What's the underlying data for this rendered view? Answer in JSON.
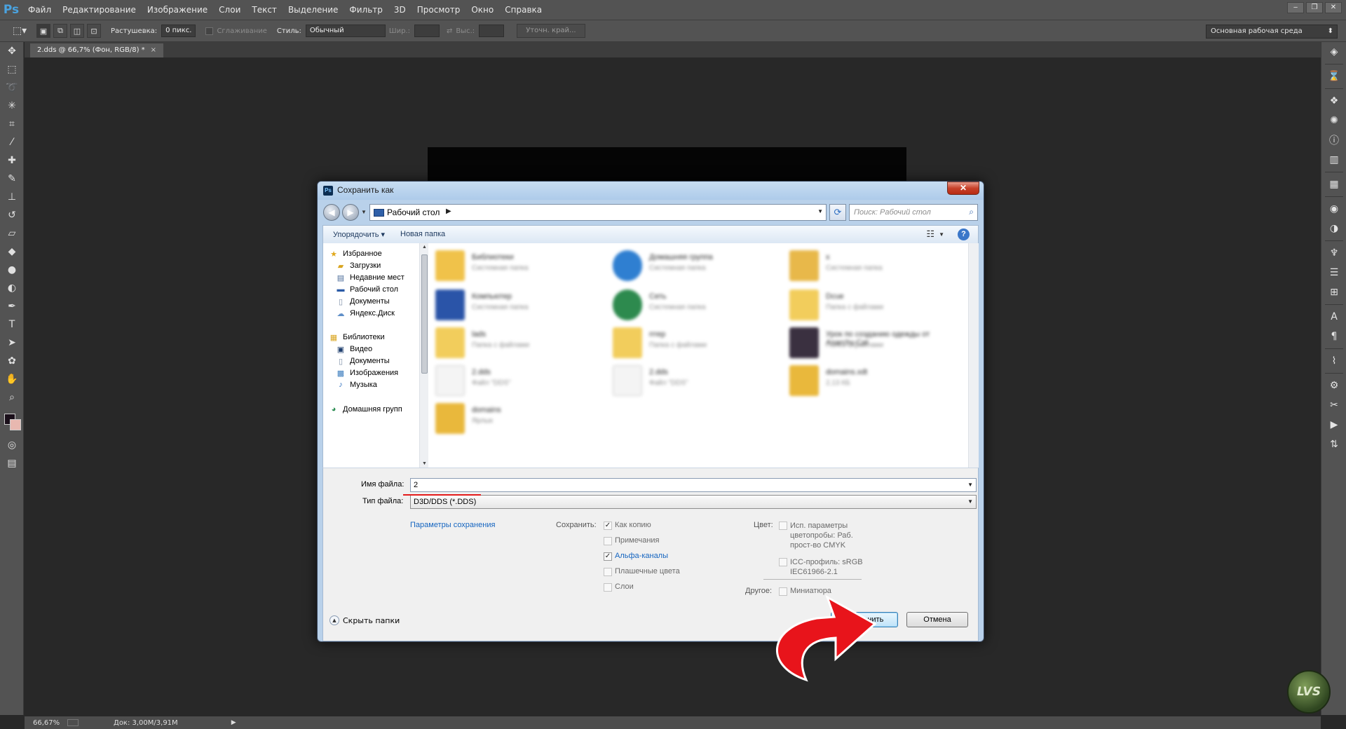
{
  "app": {
    "logo": "Ps",
    "menu": [
      "Файл",
      "Редактирование",
      "Изображение",
      "Слои",
      "Текст",
      "Выделение",
      "Фильтр",
      "3D",
      "Просмотр",
      "Окно",
      "Справка"
    ],
    "window_buttons": [
      "‒",
      "❐",
      "✕"
    ]
  },
  "options": {
    "feather_label": "Растушевка:",
    "feather_value": "0 пикс.",
    "antialias_label": "Сглаживание",
    "style_label": "Стиль:",
    "style_value": "Обычный",
    "width_label": "Шир.:",
    "height_label": "Выс.:",
    "refine_button": "Уточн. край...",
    "workspace": "Основная рабочая среда"
  },
  "document": {
    "tab_title": "2.dds @ 66,7% (Фон, RGB/8) *",
    "tab_close": "×"
  },
  "status": {
    "zoom": "66,67%",
    "doc_info": "Док: 3,00M/3,91M",
    "arrow": "▶"
  },
  "dialog": {
    "title": "Сохранить как",
    "close": "✕",
    "address": "Рабочий стол",
    "search_placeholder": "Поиск: Рабочий стол",
    "toolbar": {
      "organize": "Упорядочить ▾",
      "new_folder": "Новая папка",
      "help": "?"
    },
    "nav": {
      "favorites_header": "Избранное",
      "favorites": [
        "Загрузки",
        "Недавние мест",
        "Рабочий стол",
        "Документы",
        "Яндекс.Диск"
      ],
      "libraries_header": "Библиотеки",
      "libraries": [
        "Видео",
        "Документы",
        "Изображения",
        "Музыка"
      ],
      "homegroup": "Домашняя групп"
    },
    "files": [
      {
        "name": "Библиотеки",
        "sub": "Системная папка",
        "color": "#f0c24a"
      },
      {
        "name": "Домашняя группа",
        "sub": "Системная папка",
        "color": "#2f7fd1"
      },
      {
        "name": "x",
        "sub": "Системная папка",
        "color": "#e8b84a"
      },
      {
        "name": "Компьютер",
        "sub": "Системная папка",
        "color": "#2a54a8"
      },
      {
        "name": "Сеть",
        "sub": "Системная папка",
        "color": "#2d8a4e"
      },
      {
        "name": "Dcue",
        "sub": "Папка с файлами",
        "color": "#f2cd5c"
      },
      {
        "name": "lads",
        "sub": "Папка с файлами",
        "color": "#f2cd5c"
      },
      {
        "name": "rrrеp",
        "sub": "Папка с файлами",
        "color": "#f2cd5c"
      },
      {
        "name": "Урок по созданию одежды от Anarchy Cat",
        "sub": "Папка с файлами",
        "color": "#3a3040"
      },
      {
        "name": "2.dds",
        "sub": "Файл \"DDS\"",
        "color": "#f4f4f4"
      },
      {
        "name": "2.dds",
        "sub": "Файл \"DDS\"",
        "color": "#f4f4f4"
      },
      {
        "name": "domains.xdt",
        "sub": "2,13 КБ",
        "color": "#e9b83c"
      },
      {
        "name": "domains",
        "sub": "Ярлык",
        "color": "#e9b83c"
      }
    ],
    "filename_label": "Имя файла:",
    "filename_value": "2",
    "filetype_label": "Тип файла:",
    "filetype_value": "D3D/DDS (*.DDS)",
    "save_options_link": "Параметры сохранения",
    "save_label": "Сохранить:",
    "save_checks": [
      {
        "label": "Как копию",
        "checked": true,
        "active": false
      },
      {
        "label": "Примечания",
        "checked": false,
        "active": false
      },
      {
        "label": "Альфа-каналы",
        "checked": true,
        "active": true
      },
      {
        "label": "Плашечные цвета",
        "checked": false,
        "active": false
      },
      {
        "label": "Слои",
        "checked": false,
        "active": false
      }
    ],
    "color_label": "Цвет:",
    "color_check_1": "Исп. параметры цветопробы:  Раб. прост-во CMYK",
    "color_check_2": "ICC-профиль:  sRGB IEC61966-2.1",
    "other_label": "Другое:",
    "thumbnail_check": "Миниатюра",
    "hide_folders": "Скрыть папки",
    "save_button": "Сохранить",
    "cancel_button": "Отмена"
  },
  "watermark": "LVS",
  "colors": {
    "arrow": "#e8141b",
    "type_underline": "#e31b1b",
    "link": "#1565c0"
  }
}
